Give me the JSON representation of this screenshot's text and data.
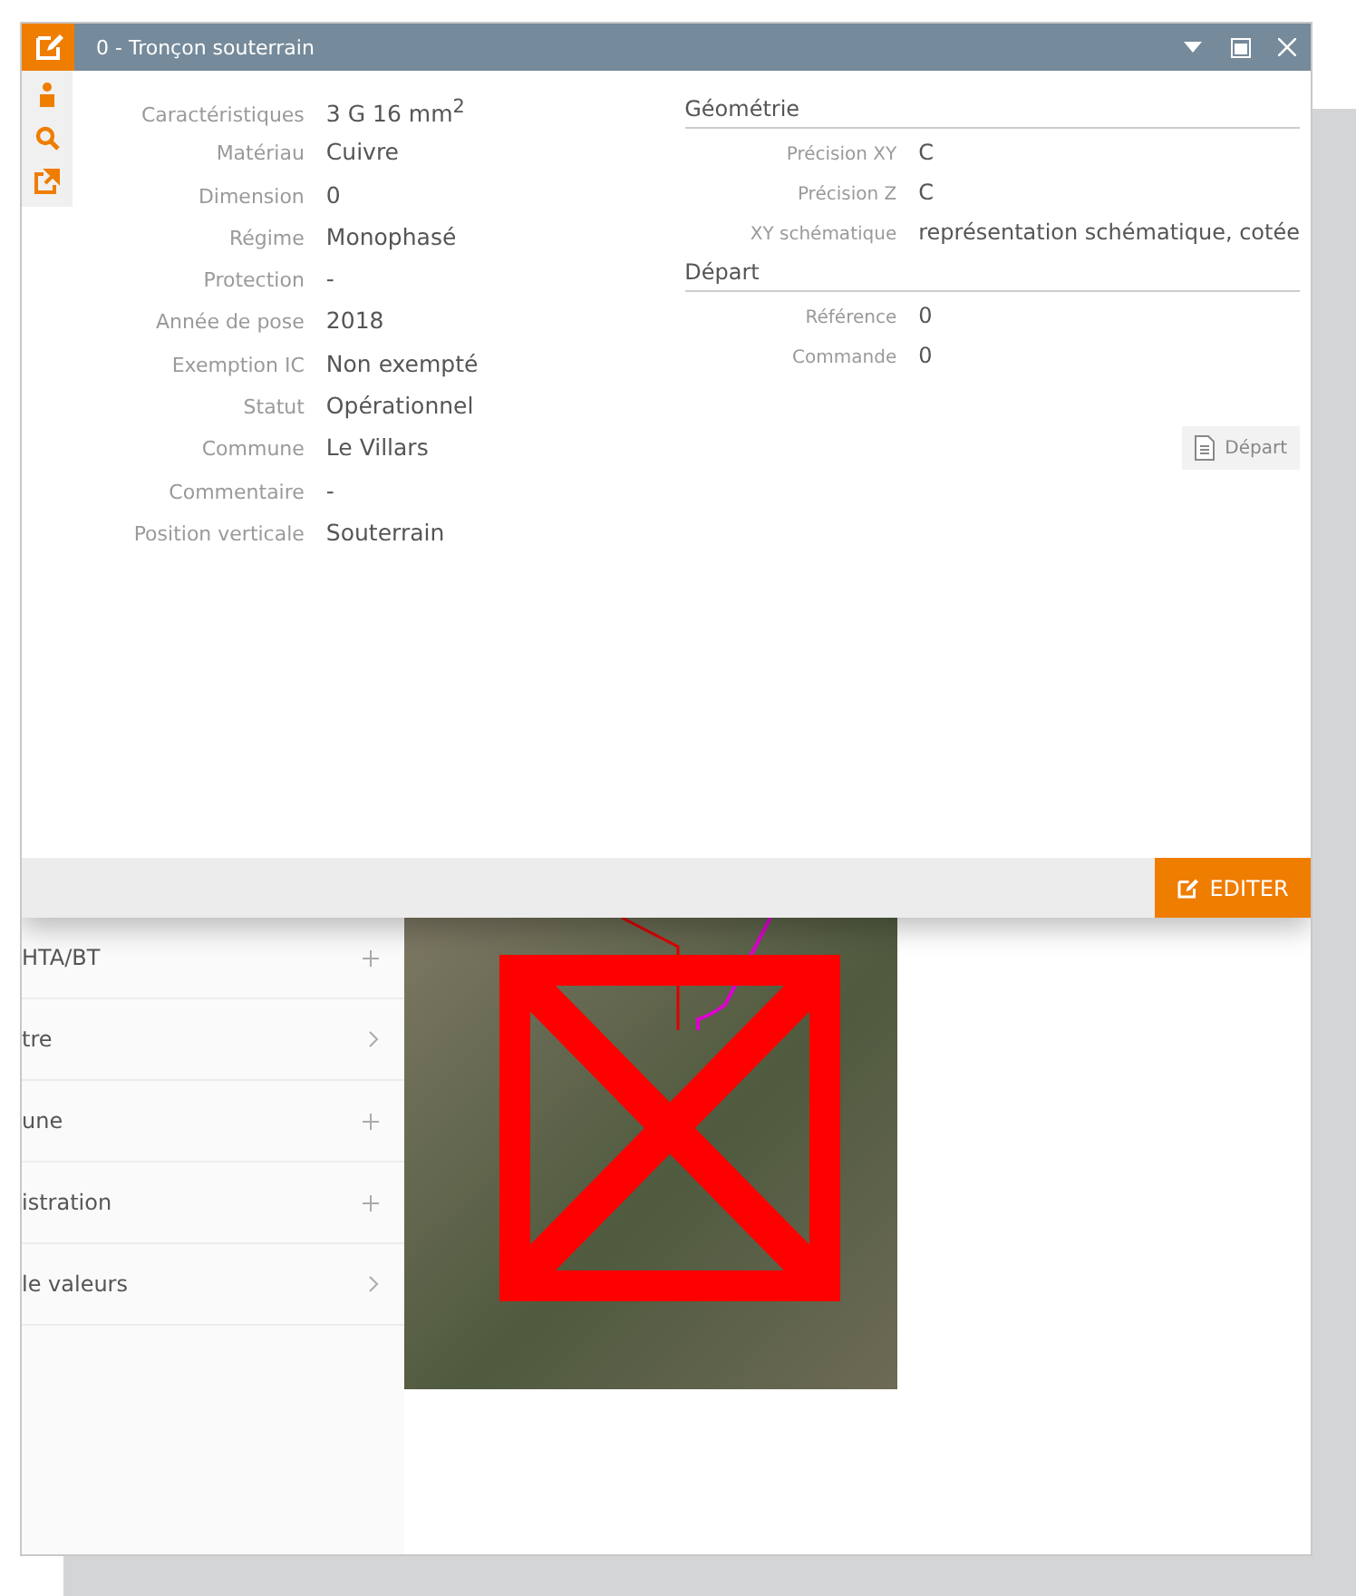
{
  "window": {
    "title": "0 - Tronçon souterrain"
  },
  "fields": [
    {
      "label": "Caractéristiques",
      "value": "3 G 16 mm$^{2}$"
    },
    {
      "label": "Matériau",
      "value": "Cuivre"
    },
    {
      "label": "Dimension",
      "value": "0"
    },
    {
      "label": "Régime",
      "value": "Monophasé"
    },
    {
      "label": "Protection",
      "value": "-"
    },
    {
      "label": "Année de pose",
      "value": "2018"
    },
    {
      "label": "Exemption IC",
      "value": "Non exempté"
    },
    {
      "label": "Statut",
      "value": "Opérationnel"
    },
    {
      "label": "Commune",
      "value": "Le Villars"
    },
    {
      "label": "Commentaire",
      "value": "-"
    },
    {
      "label": "Position verticale",
      "value": "Souterrain"
    }
  ],
  "sections": [
    {
      "title": "Géométrie",
      "fields": [
        {
          "label": "Précision XY",
          "value": "C"
        },
        {
          "label": "Précision Z",
          "value": "C"
        },
        {
          "label": "XY schématique",
          "value": "représentation schématique, cotée"
        }
      ]
    },
    {
      "title": "Départ",
      "fields": [
        {
          "label": "Référence",
          "value": "0"
        },
        {
          "label": "Commande",
          "value": "0"
        }
      ]
    }
  ],
  "depart_button": "Départ",
  "edit_button": "EDITER",
  "sidebar": {
    "items": [
      {
        "label": "HTA/BT",
        "kind": "expand"
      },
      {
        "label": "tre",
        "kind": "link"
      },
      {
        "label": "une",
        "kind": "expand"
      },
      {
        "label": "istration",
        "kind": "expand"
      },
      {
        "label": "le valeurs",
        "kind": "link"
      }
    ]
  }
}
